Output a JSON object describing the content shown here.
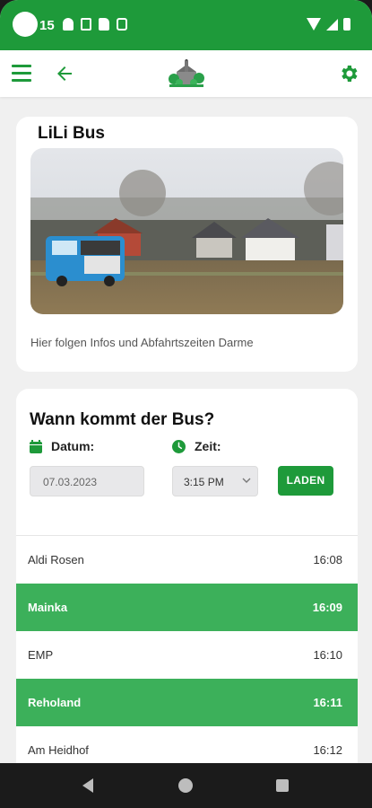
{
  "status_bar": {
    "time": "15",
    "colors": {
      "background": "#1e9a3a",
      "foreground": "#ffffff"
    },
    "icons": [
      "bell-icon",
      "a-icon",
      "sd-card-icon",
      "s-icon",
      "wifi-icon",
      "signal-icon",
      "battery-icon"
    ]
  },
  "appbar": {
    "menu_icon": "hamburger-menu-icon",
    "back_icon": "arrow-left-icon",
    "logo": "town-logo",
    "settings_icon": "gear-icon"
  },
  "info_card": {
    "title": "LiLi Bus",
    "image": "bus-in-field-photo",
    "text": "Hier folgen Infos und Abfahrtszeiten Darme"
  },
  "schedule": {
    "title": "Wann kommt der Bus?",
    "date_label": "Datum:",
    "date_value": "07.03.2023",
    "time_label": "Zeit:",
    "time_value": "3:15 PM",
    "load_button": "LADEN",
    "stops": [
      {
        "name": "Aldi Rosen",
        "time": "16:08",
        "highlight": false
      },
      {
        "name": "Mainka",
        "time": "16:09",
        "highlight": true
      },
      {
        "name": "EMP",
        "time": "16:10",
        "highlight": false
      },
      {
        "name": "Reholand",
        "time": "16:11",
        "highlight": true
      },
      {
        "name": "Am Heidhof",
        "time": "16:12",
        "highlight": false
      }
    ]
  },
  "colors": {
    "accent": "#1e9a3a",
    "row_highlight": "#3cb05a",
    "page_background": "#f0f0f0"
  }
}
